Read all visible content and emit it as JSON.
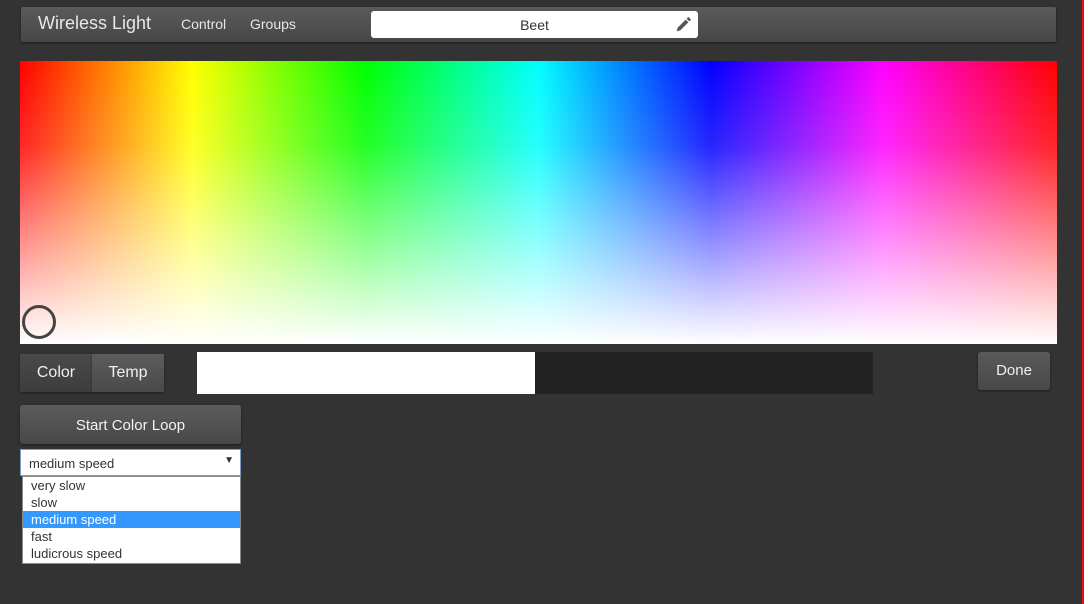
{
  "navbar": {
    "brand": "Wireless Light",
    "links": [
      {
        "label": "Control"
      },
      {
        "label": "Groups"
      }
    ],
    "device_name": "Beet",
    "edit_icon": "pencil-icon"
  },
  "picker": {
    "handle_icon": "circle-handle"
  },
  "tabs": [
    {
      "label": "Color",
      "active": true
    },
    {
      "label": "Temp",
      "active": false
    }
  ],
  "brightness": {
    "level_percent": 50
  },
  "done_label": "Done",
  "color_loop": {
    "button_label": "Start Color Loop",
    "speed_selected": "medium speed",
    "speed_options": [
      "very slow",
      "slow",
      "medium speed",
      "fast",
      "ludicrous speed"
    ],
    "arrow_glyph": "▼"
  }
}
